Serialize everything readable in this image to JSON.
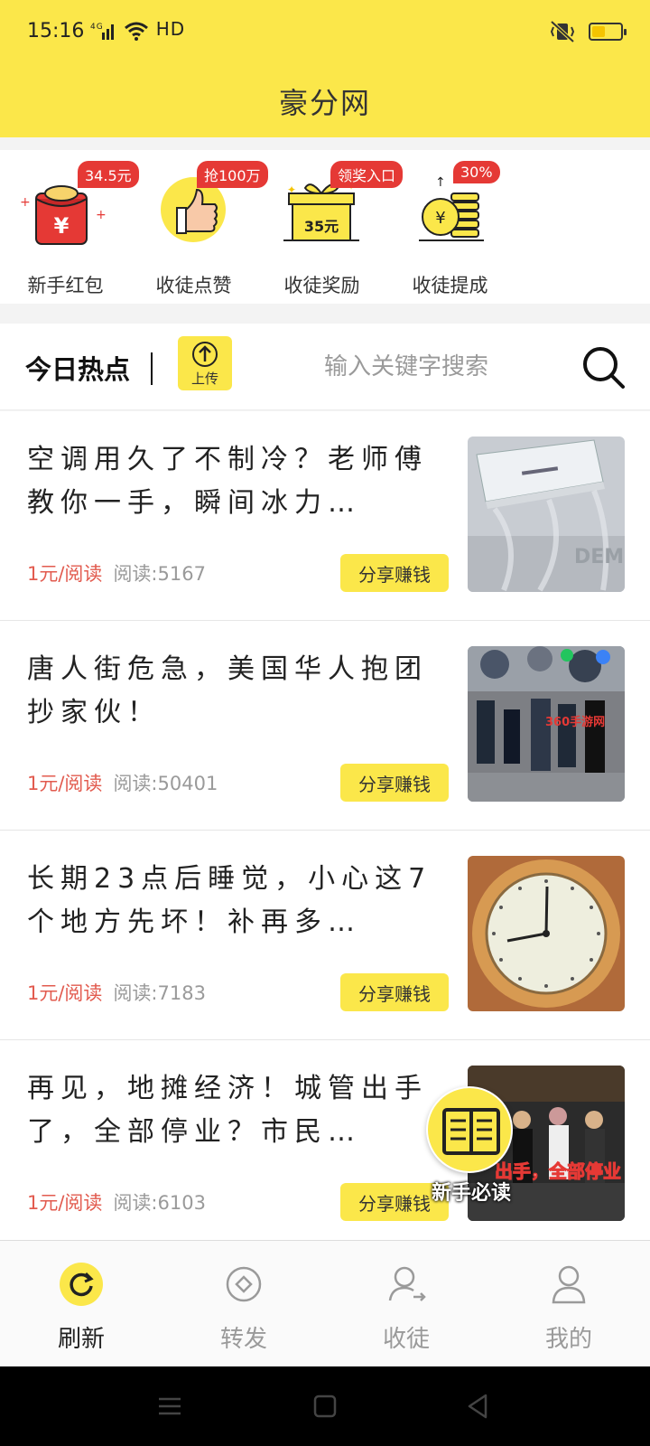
{
  "status": {
    "time": "15:16",
    "network": "HD",
    "signal_label": "4G"
  },
  "app": {
    "title": "豪分网"
  },
  "shortcuts": [
    {
      "label": "新手红包",
      "badge": "34.5元",
      "icon": "red-envelope-icon",
      "icon_text": "¥"
    },
    {
      "label": "收徒点赞",
      "badge": "抢100万",
      "icon": "thumbs-up-icon"
    },
    {
      "label": "收徒奖励",
      "badge": "领奖入口",
      "icon": "gift-box-icon",
      "icon_text": "35元"
    },
    {
      "label": "收徒提成",
      "badge": "30%",
      "icon": "coin-stack-icon",
      "icon_text": "¥"
    }
  ],
  "hot": {
    "title": "今日热点",
    "upload_label": "上传",
    "search_placeholder": "输入关键字搜索"
  },
  "articles": [
    {
      "title": "空调用久了不制冷？老师傅教你一手，瞬间冰力…",
      "price": "1元/阅读",
      "reads": "阅读:5167",
      "share": "分享赚钱",
      "thumb": "air-conditioner-image",
      "thumb_text": "DEMO"
    },
    {
      "title": "唐人街危急，美国华人抱团抄家伙！",
      "price": "1元/阅读",
      "reads": "阅读:50401",
      "share": "分享赚钱",
      "thumb": "crowd-protest-image",
      "thumb_text": "360手游网"
    },
    {
      "title": "长期23点后睡觉，小心这7个地方先坏！补再多…",
      "price": "1元/阅读",
      "reads": "阅读:7183",
      "share": "分享赚钱",
      "thumb": "clock-image"
    },
    {
      "title": "再见，地摊经济！城管出手了，全部停业？市民…",
      "price": "1元/阅读",
      "reads": "阅读:6103",
      "share": "分享赚钱",
      "thumb": "street-police-image",
      "thumb_text": "出手，全部停业"
    }
  ],
  "float_guide": {
    "label": "新手必读",
    "icon": "book-icon"
  },
  "tabs": [
    {
      "label": "刷新",
      "icon": "refresh-icon",
      "active": true
    },
    {
      "label": "转发",
      "icon": "share-diamond-icon",
      "active": false
    },
    {
      "label": "收徒",
      "icon": "add-user-icon",
      "active": false
    },
    {
      "label": "我的",
      "icon": "user-icon",
      "active": false
    }
  ],
  "colors": {
    "accent": "#fbe74a",
    "price": "#e25b4f",
    "badge": "#e53935"
  }
}
